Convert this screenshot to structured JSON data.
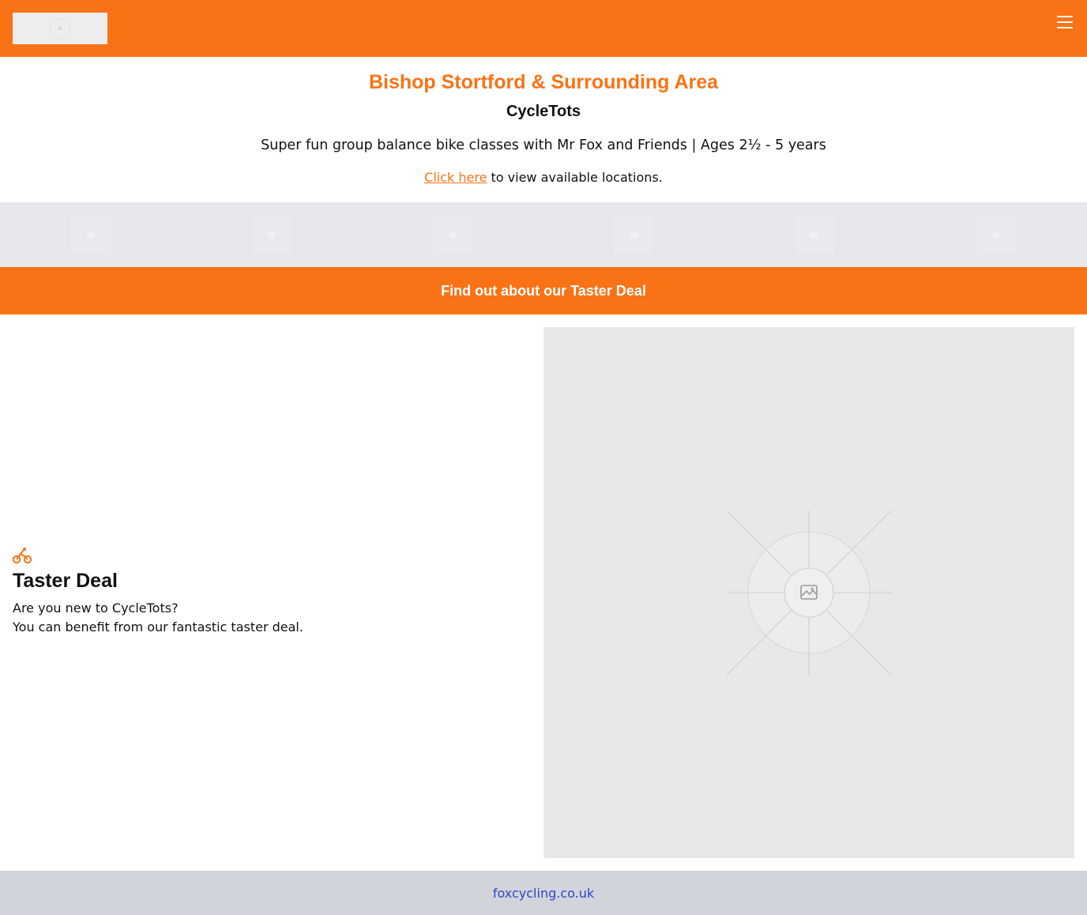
{
  "header": {
    "logo_icon": "image-placeholder-icon",
    "menu_icon": "hamburger-menu-icon",
    "background_color": "#f97316"
  },
  "intro": {
    "area_title": "Bishop Stortford & Surrounding Area",
    "brand": "CycleTots",
    "tagline": "Super fun group balance bike classes with Mr Fox and Friends | Ages 2½ - 5 years",
    "locations_link": "Click here",
    "locations_text": " to view available locations."
  },
  "partner_logos": {
    "count": 6,
    "icon": "image-placeholder-icon"
  },
  "cta": {
    "label": "Find out about our Taster Deal"
  },
  "feature": {
    "icon": "bicycle-icon",
    "title": "Taster Deal",
    "line1": "Are you new to CycleTots?",
    "line2": "You can benefit from our fantastic taster deal.",
    "image_icon": "image-placeholder-icon"
  },
  "footer": {
    "link": "foxcycling.co.uk"
  },
  "colors": {
    "accent": "#f97316",
    "strip": "#e5e7eb",
    "footer": "#d1d5db",
    "link": "#2f45c9"
  }
}
